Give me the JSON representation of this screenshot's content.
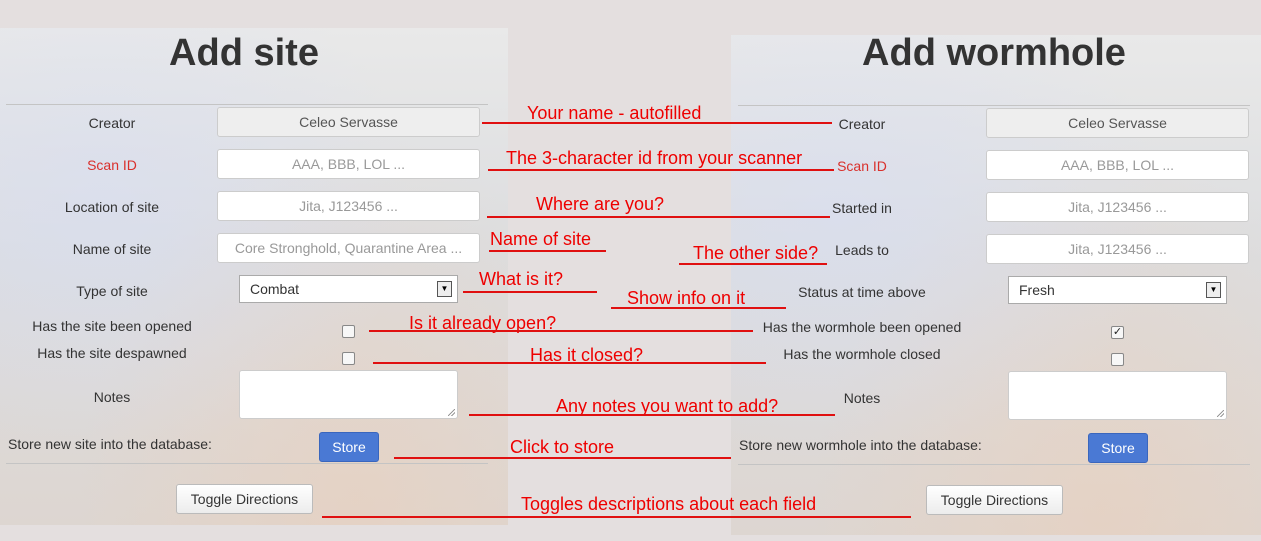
{
  "site": {
    "title": "Add site",
    "creator_label": "Creator",
    "creator_value": "Celeo Servasse",
    "scan_id_label": "Scan ID",
    "scan_id_placeholder": "AAA, BBB, LOL ...",
    "location_label": "Location of site",
    "location_placeholder": "Jita, J123456 ...",
    "name_label": "Name of site",
    "name_placeholder": "Core Stronghold, Quarantine Area ...",
    "type_label": "Type of site",
    "type_value": "Combat",
    "opened_label": "Has the site been opened",
    "opened_checked": false,
    "despawned_label": "Has the site despawned",
    "despawned_checked": false,
    "notes_label": "Notes",
    "store_text": "Store new site into the database:",
    "store_button": "Store",
    "toggle_button": "Toggle Directions"
  },
  "wormhole": {
    "title": "Add wormhole",
    "creator_label": "Creator",
    "creator_value": "Celeo Servasse",
    "scan_id_label": "Scan ID",
    "scan_id_placeholder": "AAA, BBB, LOL ...",
    "started_label": "Started in",
    "started_placeholder": "Jita, J123456 ...",
    "leads_label": "Leads to",
    "leads_placeholder": "Jita, J123456 ...",
    "status_label": "Status at time above",
    "status_value": "Fresh",
    "opened_label": "Has the wormhole been opened",
    "opened_checked": true,
    "closed_label": "Has the wormhole closed",
    "closed_checked": false,
    "notes_label": "Notes",
    "store_text": "Store new wormhole into the database:",
    "store_button": "Store",
    "toggle_button": "Toggle Directions"
  },
  "annotations": {
    "name": "Your name - autofilled",
    "scan_id": "The 3-character id from your scanner",
    "location": "Where are you?",
    "site_name": "Name of site",
    "other_side": "The other side?",
    "type": "What is it?",
    "status": "Show info on it",
    "opened": "Is it already open?",
    "closed": "Has it closed?",
    "notes": "Any notes you want to add?",
    "store": "Click to store",
    "toggle": "Toggles descriptions about each field"
  },
  "colors": {
    "annotation": "#e01010",
    "primary_button": "#4a79d4",
    "required_label": "#d9302c"
  }
}
